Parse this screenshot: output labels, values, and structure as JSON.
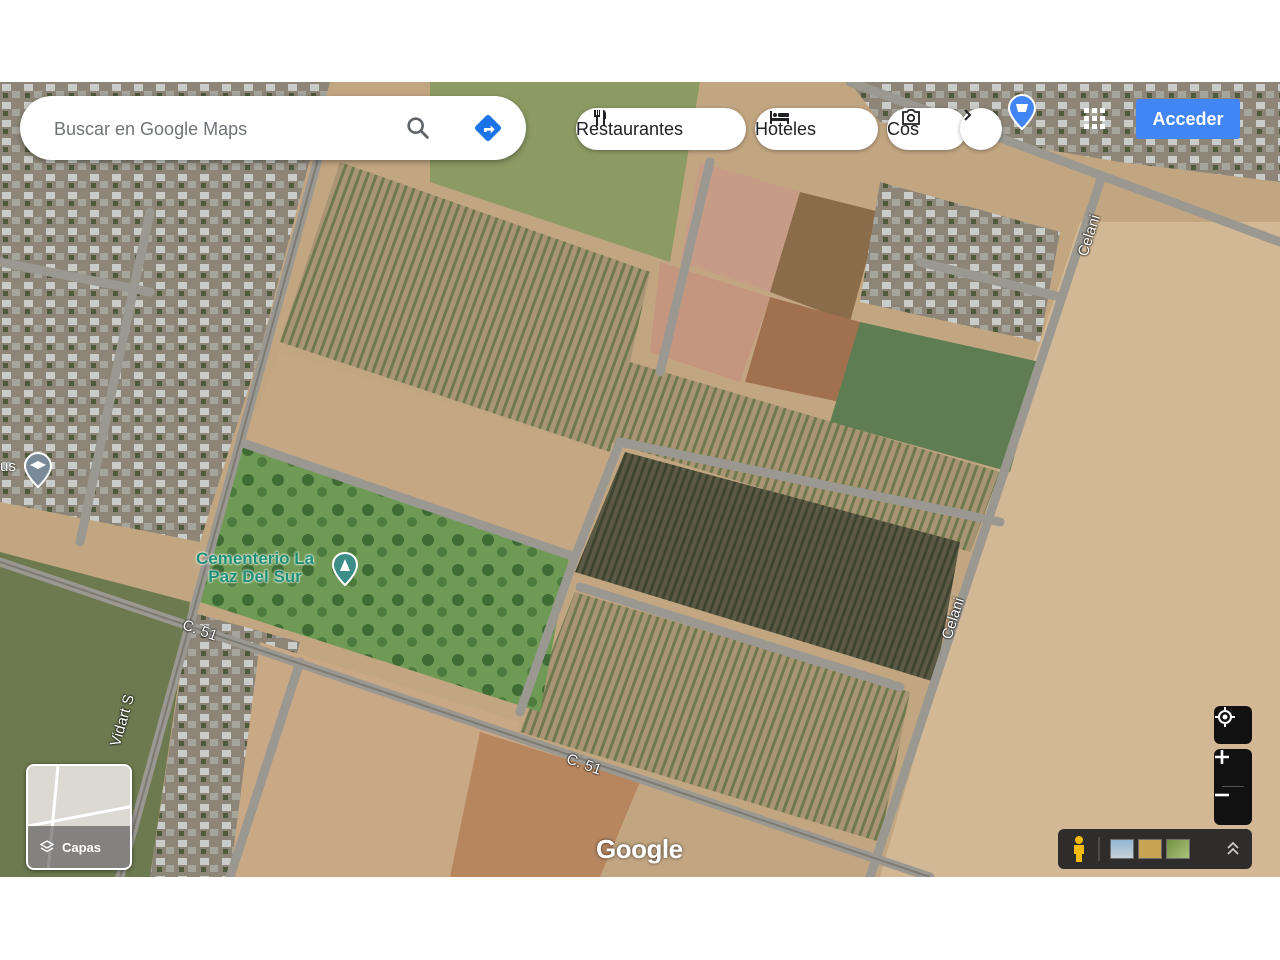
{
  "search": {
    "placeholder": "Buscar en Google Maps"
  },
  "chips": [
    {
      "label": "Restaurantes",
      "icon": "fork-knife-icon"
    },
    {
      "label": "Hoteles",
      "icon": "bed-icon"
    },
    {
      "label": "Cos",
      "icon": "camera-icon"
    }
  ],
  "header": {
    "signin_label": "Acceder"
  },
  "map": {
    "type": "satellite",
    "places": [
      {
        "name_line1": "Cementerio La",
        "name_line2": "Paz Del Sur",
        "icon": "place-pin-icon"
      }
    ],
    "road_labels": [
      "Celani",
      "Celani",
      "C. 51",
      "C. 51",
      "Vidart S"
    ],
    "edge_label": "us",
    "watermark": "Google"
  },
  "layers": {
    "label": "Capas"
  },
  "colors": {
    "accent": "#4285f4",
    "pin_teal": "#3c8c88",
    "shopping_pin": "#4285f4"
  }
}
